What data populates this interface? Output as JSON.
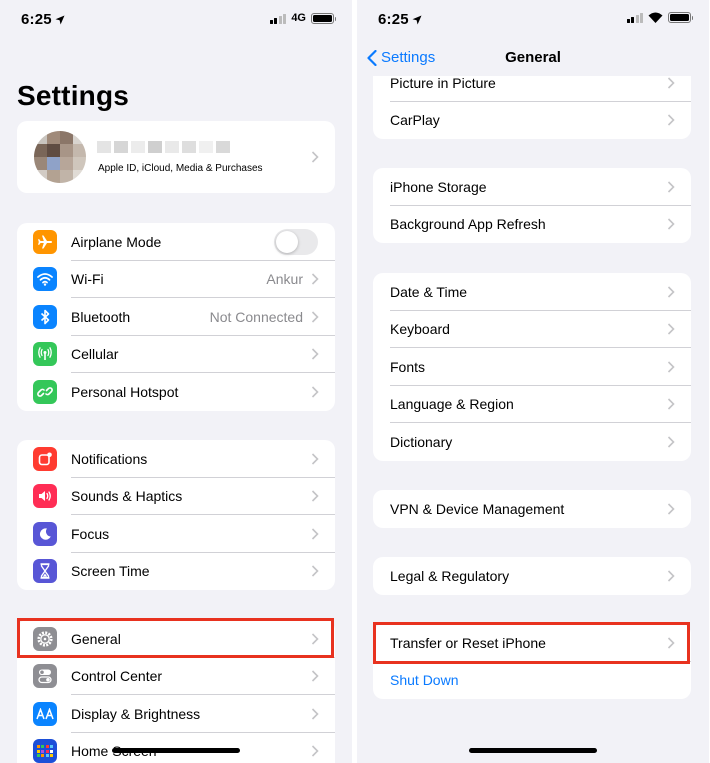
{
  "left_screen": {
    "status": {
      "time": "6:25",
      "network": "4G"
    },
    "title": "Settings",
    "profile": {
      "subtitle": "Apple ID, iCloud, Media & Purchases"
    },
    "group1": [
      {
        "label": "Airplane Mode",
        "icon": "airplane-icon",
        "color": "#ff9500",
        "toggle": "off"
      },
      {
        "label": "Wi-Fi",
        "icon": "wifi-icon",
        "color": "#0a84ff",
        "value": "Ankur"
      },
      {
        "label": "Bluetooth",
        "icon": "bluetooth-icon",
        "color": "#0a84ff",
        "value": "Not Connected"
      },
      {
        "label": "Cellular",
        "icon": "antenna-icon",
        "color": "#34c759"
      },
      {
        "label": "Personal Hotspot",
        "icon": "hotspot-link-icon",
        "color": "#34c759"
      }
    ],
    "group2": [
      {
        "label": "Notifications",
        "icon": "bell-icon",
        "color": "#ff3b30"
      },
      {
        "label": "Sounds & Haptics",
        "icon": "speaker-icon",
        "color": "#ff2d55"
      },
      {
        "label": "Focus",
        "icon": "moon-icon",
        "color": "#5856d6"
      },
      {
        "label": "Screen Time",
        "icon": "hourglass-icon",
        "color": "#5856d6"
      }
    ],
    "group3": [
      {
        "label": "General",
        "icon": "gear-icon",
        "color": "#8e8e93"
      },
      {
        "label": "Control Center",
        "icon": "switches-icon",
        "color": "#8e8e93"
      },
      {
        "label": "Display & Brightness",
        "icon": "text-size-icon",
        "color": "#0a84ff"
      },
      {
        "label": "Home Screen",
        "icon": "app-grid-icon",
        "color": "#1c4fd8"
      }
    ]
  },
  "right_screen": {
    "status": {
      "time": "6:25"
    },
    "nav": {
      "back_label": "Settings",
      "title": "General"
    },
    "group_a": [
      "Picture in Picture",
      "CarPlay"
    ],
    "group_b": [
      "iPhone Storage",
      "Background App Refresh"
    ],
    "group_c": [
      "Date & Time",
      "Keyboard",
      "Fonts",
      "Language & Region",
      "Dictionary"
    ],
    "group_d": [
      "VPN & Device Management"
    ],
    "group_e": [
      "Legal & Regulatory"
    ],
    "group_f": {
      "reset_label": "Transfer or Reset iPhone",
      "shutdown_label": "Shut Down"
    }
  },
  "colors": {
    "highlight": "#e8321f",
    "link": "#0a7aff",
    "background": "#f2f2f7"
  }
}
